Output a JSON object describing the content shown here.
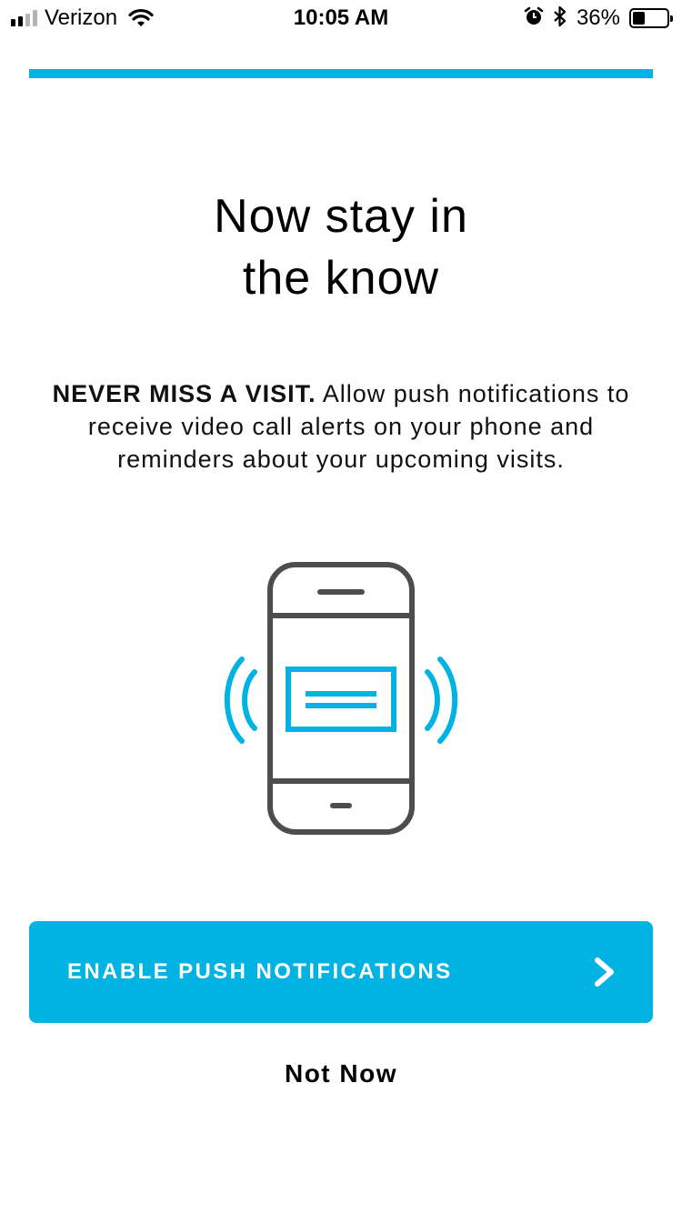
{
  "status_bar": {
    "carrier": "Verizon",
    "time": "10:05 AM",
    "battery_percent": "36%",
    "battery_level": 0.36,
    "signal_bars_active": 2,
    "signal_bars_total": 4,
    "icons": [
      "signal-icon",
      "wifi-icon",
      "alarm-icon",
      "bluetooth-icon",
      "battery-icon"
    ]
  },
  "progress": {
    "value": 1.0
  },
  "content": {
    "headline": "Now stay in\nthe know",
    "body_lead": "NEVER MISS A VISIT.",
    "body_text": " Allow push notifications to receive video call alerts on your phone and reminders about your upcoming visits.",
    "illustration_icon": "vibrating-phone-notification-icon"
  },
  "actions": {
    "primary_label": "ENABLE PUSH NOTIFICATIONS",
    "primary_icon": "chevron-right-icon",
    "secondary_label": "Not Now"
  },
  "colors": {
    "accent": "#00b3e3",
    "phone_outline": "#4d4d4d",
    "text": "#000000",
    "background": "#ffffff"
  }
}
